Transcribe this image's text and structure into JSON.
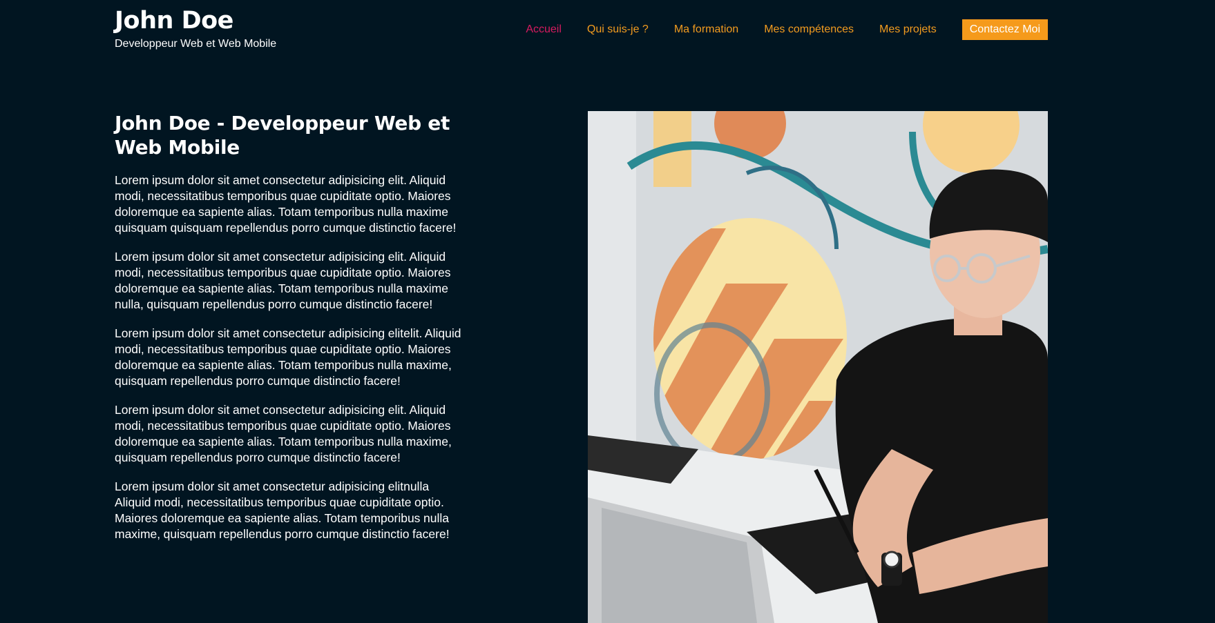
{
  "header": {
    "brand_name": "John Doe",
    "tagline": "Developpeur Web et Web Mobile"
  },
  "nav": {
    "items": [
      {
        "label": "Accueil",
        "active": true
      },
      {
        "label": "Qui suis-je ?"
      },
      {
        "label": "Ma formation"
      },
      {
        "label": "Mes compétences"
      },
      {
        "label": "Mes projets"
      }
    ],
    "cta_label": "Contactez Moi"
  },
  "hero": {
    "title": "John Doe - Developpeur Web et Web Mobile",
    "paragraphs": [
      "Lorem ipsum dolor sit amet consectetur adipisicing elit. Aliquid modi, necessitatibus temporibus quae cupiditate optio. Maiores doloremque ea sapiente alias. Totam temporibus nulla maxime quisquam quisquam repellendus porro cumque distinctio facere!",
      "Lorem ipsum dolor sit amet consectetur adipisicing elit. Aliquid modi, necessitatibus temporibus quae cupiditate optio. Maiores doloremque ea sapiente alias. Totam temporibus nulla maxime nulla, quisquam repellendus porro cumque distinctio facere!",
      "Lorem ipsum dolor sit amet consectetur adipisicing elitelit. Aliquid modi, necessitatibus temporibus quae cupiditate optio. Maiores doloremque ea sapiente alias. Totam temporibus nulla maxime, quisquam repellendus porro cumque distinctio facere!",
      "Lorem ipsum dolor sit amet consectetur adipisicing elit. Aliquid modi, necessitatibus temporibus quae cupiditate optio. Maiores doloremque ea sapiente alias. Totam temporibus nulla maxime, quisquam repellendus porro cumque distinctio facere!",
      "Lorem ipsum dolor sit amet consectetur adipisicing elitnulla Aliquid modi, necessitatibus temporibus quae cupiditate optio. Maiores doloremque ea sapiente alias. Totam temporibus nulla maxime, quisquam repellendus porro cumque distinctio facere!"
    ]
  },
  "colors": {
    "background": "#011521",
    "nav_link": "#f39c1f",
    "nav_active": "#d81b60",
    "cta_background": "#f59a1b"
  }
}
